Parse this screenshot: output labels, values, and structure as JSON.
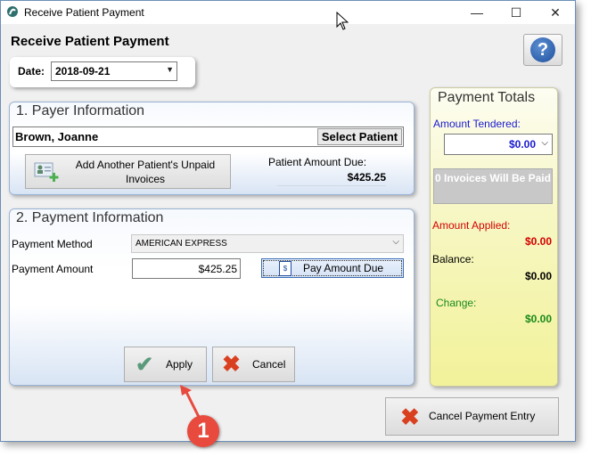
{
  "window": {
    "title": "Receive Patient Payment",
    "minimize_glyph": "—",
    "maximize_glyph": "☐",
    "close_glyph": "✕"
  },
  "header": {
    "heading": "Receive Patient Payment",
    "help_glyph": "?"
  },
  "date": {
    "label": "Date:",
    "value": "2018-09-21"
  },
  "payer": {
    "section_title": "1. Payer Information",
    "patient_name": "Brown, Joanne",
    "select_patient_label": "Select Patient",
    "add_patient_label": "Add Another Patient's Unpaid Invoices",
    "amount_due_label": "Patient Amount Due:",
    "amount_due_value": "$425.25"
  },
  "payment": {
    "section_title": "2. Payment Information",
    "method_label": "Payment Method",
    "method_value": "AMERICAN EXPRESS",
    "amount_label": "Payment Amount",
    "amount_value": "$425.25",
    "pay_due_label": "Pay Amount Due",
    "apply_label": "Apply",
    "cancel_label": "Cancel"
  },
  "totals": {
    "title": "Payment Totals",
    "tendered_label": "Amount Tendered:",
    "tendered_value": "$0.00",
    "invoices_label": "0 Invoices Will Be Paid",
    "applied_label": "Amount Applied:",
    "applied_value": "$0.00",
    "balance_label": "Balance:",
    "balance_value": "$0.00",
    "change_label": "Change:",
    "change_value": "$0.00"
  },
  "footer": {
    "cancel_entry_label": "Cancel Payment Entry"
  },
  "annotation": {
    "callout_number": "1"
  },
  "colors": {
    "accent_blue": "#1a1ad0",
    "applied_red": "#d40000",
    "change_green": "#1a8a1a",
    "cancel_x": "#d9401f",
    "apply_check": "#5a9a7a",
    "callout_red": "#e84a3e"
  },
  "icons": {
    "app": "app-logo-icon",
    "help": "help-icon",
    "add_patient": "add-person-icon",
    "pay_due": "invoice-dollar-icon",
    "apply": "checkmark-icon",
    "cancel": "x-icon",
    "cursor": "mouse-pointer-icon"
  }
}
